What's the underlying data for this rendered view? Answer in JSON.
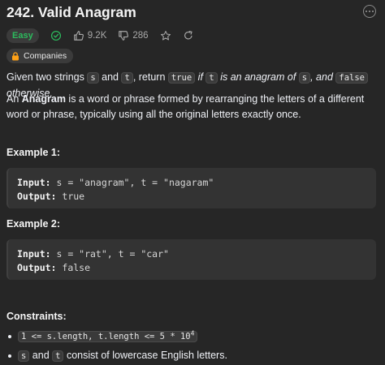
{
  "problem": {
    "title": "242. Valid Anagram",
    "difficulty": "Easy",
    "likes": "9.2K",
    "dislikes": "286",
    "companies_label": "Companies"
  },
  "description": {
    "p1": {
      "a": "Given two strings ",
      "s": "s",
      "b": " and ",
      "t": "t",
      "c": ", return ",
      "true": "true",
      "if": " if ",
      "t2": "t",
      "d": " is an anagram of ",
      "s2": "s",
      "e": ", and ",
      "false": "false",
      "f": " otherwise."
    },
    "p2": {
      "a": "An ",
      "term": "Anagram",
      "b": " is a word or phrase formed by rearranging the letters of a different word or phrase, typically using all the original letters exactly once."
    }
  },
  "examples": [
    {
      "heading": "Example 1:",
      "input_label": "Input:",
      "input": " s = \"anagram\", t = \"nagaram\"",
      "output_label": "Output:",
      "output": " true"
    },
    {
      "heading": "Example 2:",
      "input_label": "Input:",
      "input": " s = \"rat\", t = \"car\"",
      "output_label": "Output:",
      "output": " false"
    }
  ],
  "constraints": {
    "heading": "Constraints:",
    "c1_code": "1 <= s.length, t.length <= 5 * 10",
    "c1_sup": "4",
    "c2_s": "s",
    "c2_and": " and ",
    "c2_t": "t",
    "c2_rest": " consist of lowercase English letters."
  },
  "icons": [
    "solved-check-icon",
    "thumbs-up-icon",
    "thumbs-down-icon",
    "star-icon",
    "share-icon",
    "lock-icon",
    "more-icon"
  ],
  "colors": {
    "background": "#262626",
    "easy": "#2cbb5d",
    "companies_lock": "#ffa116"
  }
}
